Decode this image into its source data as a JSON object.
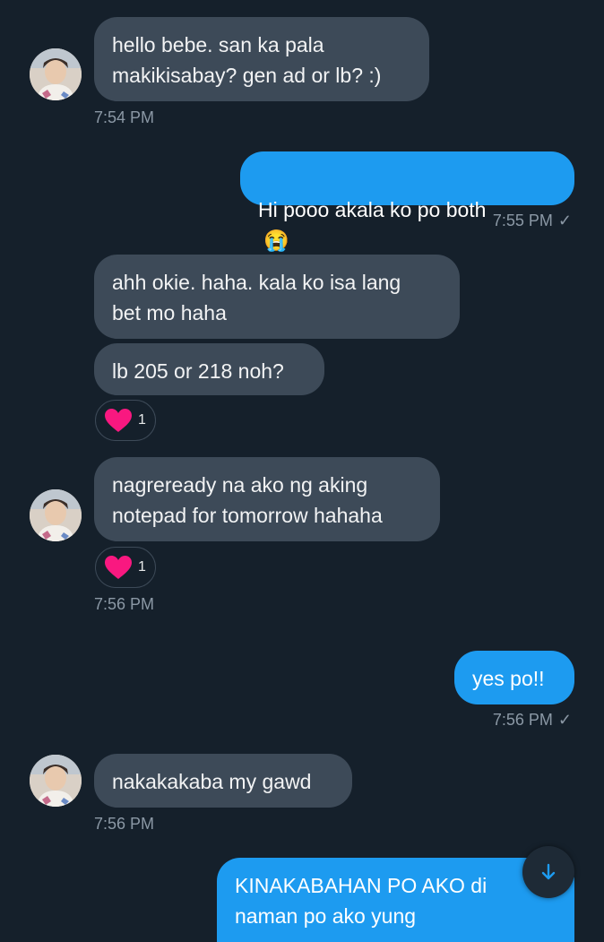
{
  "colors": {
    "background": "#15202b",
    "incoming_bubble": "#3d4a58",
    "outgoing_bubble": "#1d9bf0",
    "timestamp": "#8b98a5",
    "heart": "#f91880"
  },
  "messages": {
    "m1": {
      "text": "hello bebe. san ka pala\nmakikisabay? gen ad or lb? :)",
      "time": "7:54 PM"
    },
    "m2": {
      "text": "Hi pooo akala ko po both",
      "emoji": "😭",
      "time": "7:55 PM",
      "status_icon": "check-icon"
    },
    "m3": {
      "text": "ahh okie. haha. kala ko isa lang\nbet mo haha"
    },
    "m4": {
      "text": "lb 205 or 218 noh?",
      "reaction_count": "1"
    },
    "m5": {
      "text": "nagreready na ako ng aking\nnotepad for tomorrow hahaha",
      "reaction_count": "1",
      "time": "7:56 PM"
    },
    "m6": {
      "text": "yes po!!",
      "time": "7:56 PM",
      "status_icon": "check-icon"
    },
    "m7": {
      "text": "nakakakaba my gawd",
      "time": "7:56 PM"
    },
    "m8": {
      "text": "KINAKABAHAN PO AKO di\nnaman po ako yung"
    }
  },
  "scroll_button": {
    "icon": "arrow-down-icon"
  }
}
